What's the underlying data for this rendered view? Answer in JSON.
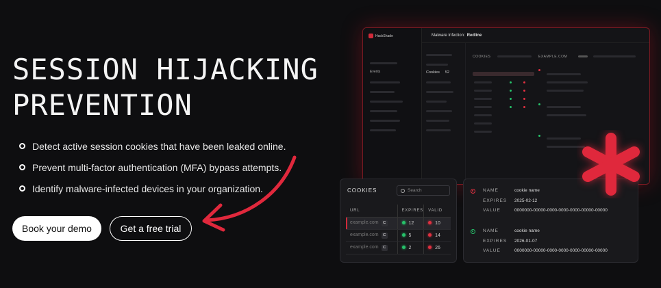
{
  "hero": {
    "title_line1": "SESSION HIJACKING",
    "title_line2": "PREVENTION",
    "bullets": [
      "Detect active session cookies that have been leaked online.",
      "Prevent multi-factor authentication (MFA) bypass attempts.",
      "Identify malware-infected devices in your organization."
    ],
    "cta_primary": "Book your demo",
    "cta_secondary": "Get a free trial"
  },
  "dashboard": {
    "brand": "HackShade",
    "header_prefix": "Malware Infection:",
    "header_name": "Redline",
    "nav_item": "Events",
    "menu_item": "Cookies",
    "menu_count": "52",
    "cookies_label": "COOKIES",
    "domain_label": "EXAMPLE.COM"
  },
  "cookies_card": {
    "title": "COOKIES",
    "search_placeholder": "Search",
    "columns": [
      "URL",
      "EXPIRES",
      "VALID"
    ],
    "rows": [
      {
        "url": "example.com",
        "badge": "C",
        "expires": "12",
        "valid": "10"
      },
      {
        "url": "example.com",
        "badge": "C",
        "expires": "5",
        "valid": "14"
      },
      {
        "url": "example.com",
        "badge": "C",
        "expires": "2",
        "valid": "26"
      }
    ]
  },
  "details_card": {
    "entries": [
      {
        "name_label": "NAME",
        "name": "cookie name",
        "expires_label": "EXPIRES",
        "expires": "2025-02-12",
        "value_label": "VALUE",
        "value": "0000000-00000-0000-0000-0000-00000-00000",
        "status": "red"
      },
      {
        "name_label": "NAME",
        "name": "cookie name",
        "expires_label": "EXPIRES",
        "expires": "2026-01-07",
        "value_label": "VALUE",
        "value": "0000000-00000-0000-0000-0000-00000-00000",
        "status": "green"
      }
    ]
  },
  "colors": {
    "accent": "#e0283c",
    "valid": "#26c26a",
    "background": "#0e0e10"
  }
}
